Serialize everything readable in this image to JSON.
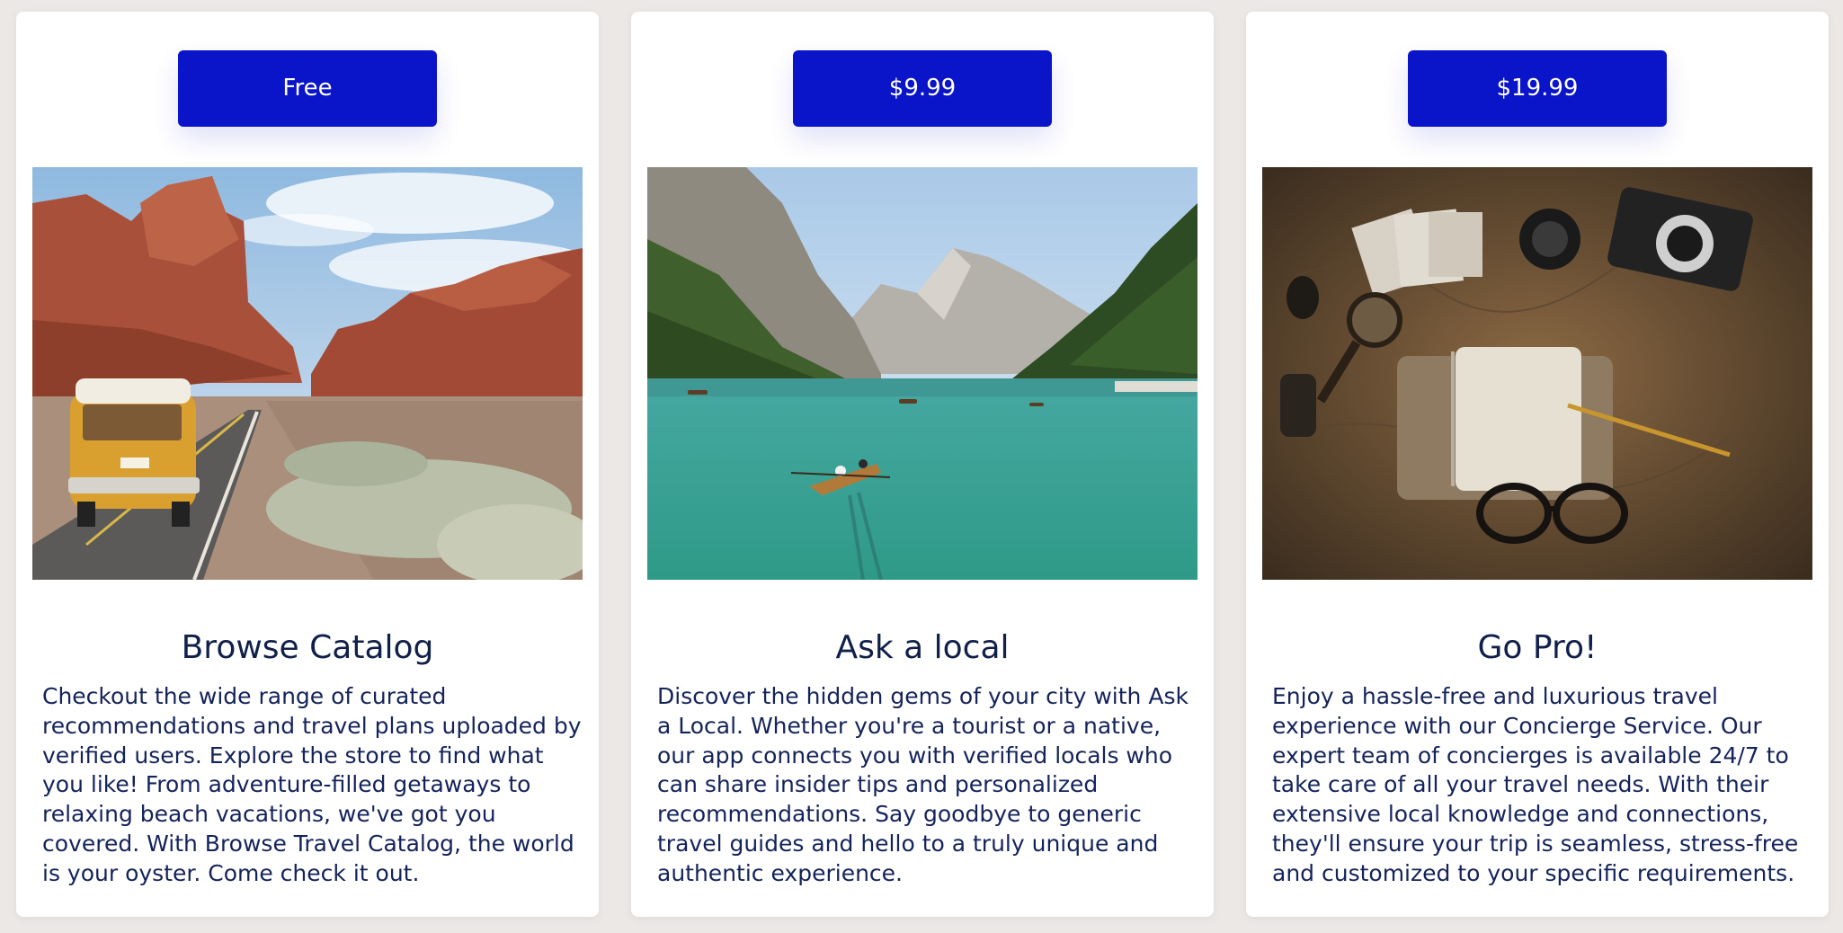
{
  "cards": [
    {
      "price": "Free",
      "title": "Browse Catalog",
      "description": "Checkout the wide range of curated recommendations and travel plans uploaded by verified users. Explore the store to find what you like! From adventure-filled getaways to relaxing beach vacations, we've got you covered. With Browse Travel Catalog, the world is your oyster. Come check it out.",
      "image": "desert road with yellow van"
    },
    {
      "price": "$9.99",
      "title": "Ask a local",
      "description": "Discover the hidden gems of your city with Ask a Local. Whether you're a tourist or a native, our app connects you with verified locals who can share insider tips and personalized recommendations. Say goodbye to generic travel guides and hello to a truly unique and authentic experience.",
      "image": "mountain lake with rowing boats"
    },
    {
      "price": "$19.99",
      "title": "Go Pro!",
      "description": "Enjoy a hassle-free and luxurious travel experience with our Concierge Service. Our expert team of concierges is available 24/7 to take care of all your travel needs. With their extensive local knowledge and connections, they'll ensure your trip is seamless, stress-free and customized to your specific requirements.",
      "image": "vintage map with camera, notebook and glasses"
    }
  ],
  "colors": {
    "button": "#0a14c8",
    "title": "#10204a",
    "text": "#14235a",
    "page_background": "#ebe8e6",
    "card_background": "#ffffff"
  }
}
